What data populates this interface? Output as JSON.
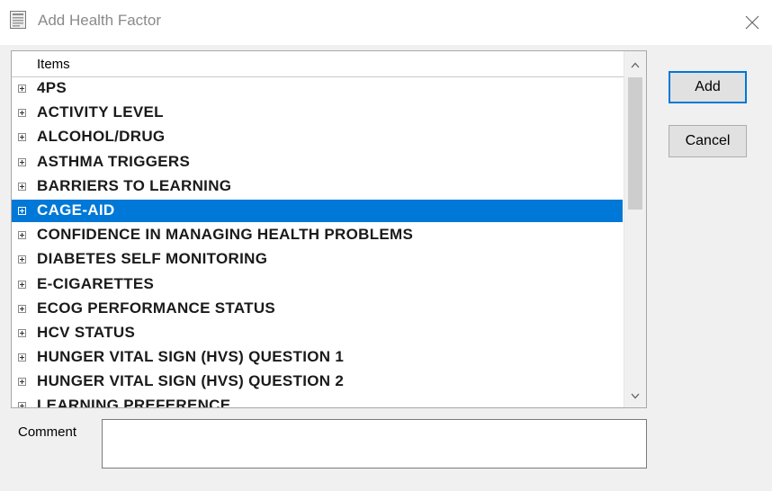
{
  "window": {
    "title": "Add Health Factor"
  },
  "list": {
    "column_header": "Items",
    "items": [
      {
        "label": "4PS",
        "selected": false
      },
      {
        "label": "ACTIVITY LEVEL",
        "selected": false
      },
      {
        "label": "ALCOHOL/DRUG",
        "selected": false
      },
      {
        "label": "ASTHMA TRIGGERS",
        "selected": false
      },
      {
        "label": "BARRIERS TO LEARNING",
        "selected": false
      },
      {
        "label": "CAGE-AID",
        "selected": true
      },
      {
        "label": "CONFIDENCE IN MANAGING HEALTH PROBLEMS",
        "selected": false
      },
      {
        "label": "DIABETES SELF MONITORING",
        "selected": false
      },
      {
        "label": "E-CIGARETTES",
        "selected": false
      },
      {
        "label": "ECOG PERFORMANCE STATUS",
        "selected": false
      },
      {
        "label": "HCV STATUS",
        "selected": false
      },
      {
        "label": "HUNGER VITAL SIGN (HVS) QUESTION 1",
        "selected": false
      },
      {
        "label": "HUNGER VITAL SIGN (HVS) QUESTION 2",
        "selected": false
      },
      {
        "label": "LEARNING PREFERENCE",
        "selected": false
      }
    ]
  },
  "buttons": {
    "add": "Add",
    "cancel": "Cancel"
  },
  "comment": {
    "label": "Comment",
    "value": ""
  },
  "colors": {
    "selection": "#0078d7",
    "default_button_border": "#0078d7"
  },
  "icons": {
    "app": "form-icon",
    "close": "close-icon",
    "expander": "plus-box-icon",
    "scroll_up": "chevron-up-icon",
    "scroll_down": "chevron-down-icon"
  }
}
